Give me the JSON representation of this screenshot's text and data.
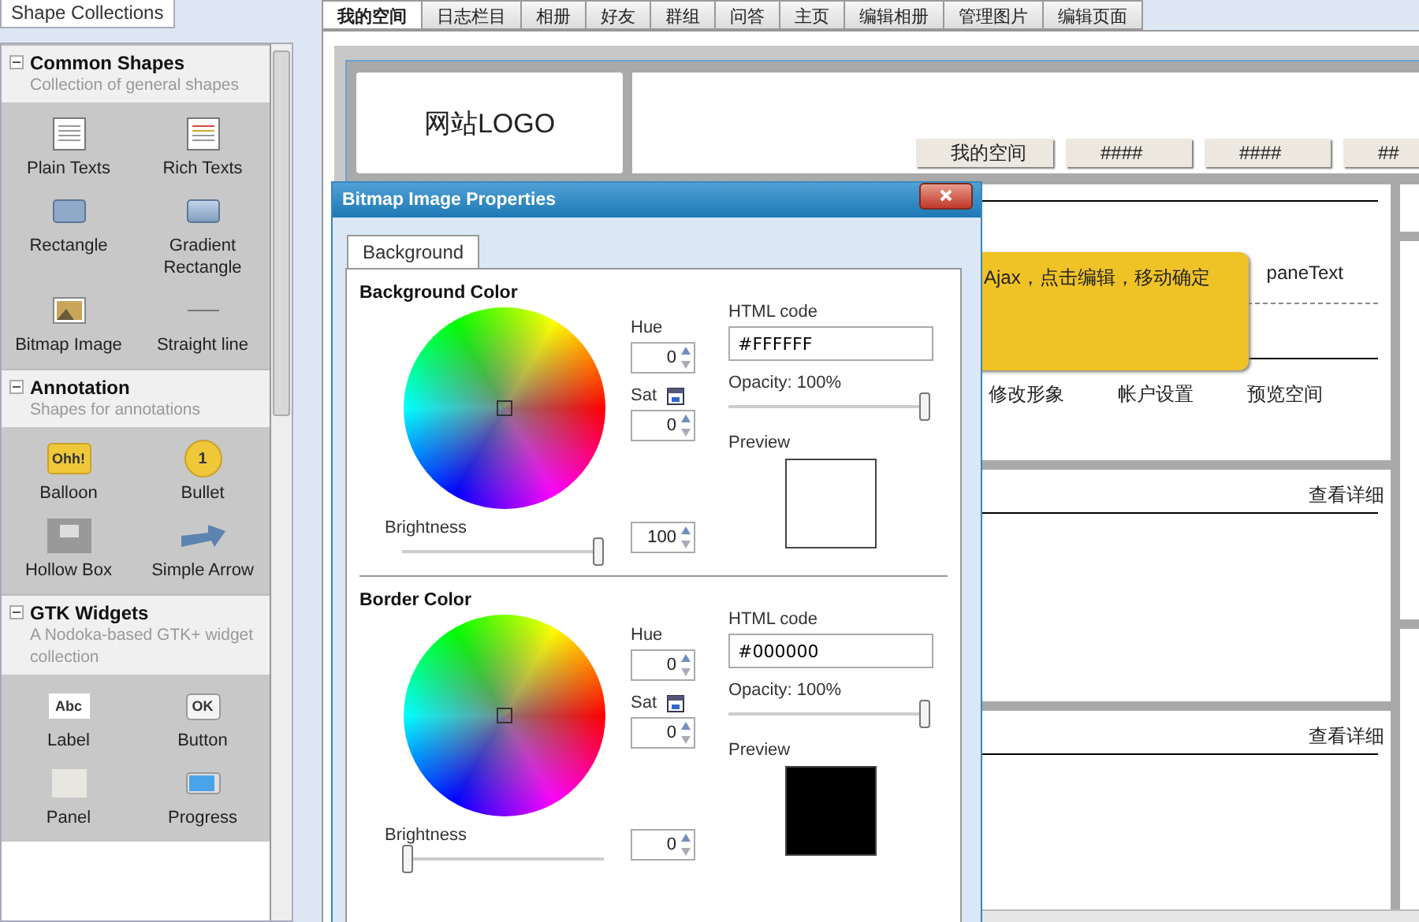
{
  "left_panel": {
    "tab": "Shape Collections",
    "sections": [
      {
        "title": "Common Shapes",
        "subtitle": "Collection of general shapes",
        "expanded": true,
        "items": [
          {
            "label": "Plain Texts",
            "kind": "plain-text"
          },
          {
            "label": "Rich Texts",
            "kind": "rich-text"
          },
          {
            "label": "Rectangle",
            "kind": "rectangle"
          },
          {
            "label": "Gradient Rectangle",
            "kind": "gradient-rectangle"
          },
          {
            "label": "Bitmap Image",
            "kind": "bitmap"
          },
          {
            "label": "Straight line",
            "kind": "line"
          }
        ]
      },
      {
        "title": "Annotation",
        "subtitle": "Shapes for annotations",
        "expanded": true,
        "items": [
          {
            "label": "Balloon",
            "kind": "balloon",
            "icon_text": "Ohh!"
          },
          {
            "label": "Bullet",
            "kind": "bullet",
            "icon_text": "1"
          },
          {
            "label": "Hollow Box",
            "kind": "hollow-box"
          },
          {
            "label": "Simple Arrow",
            "kind": "arrow"
          }
        ]
      },
      {
        "title": "GTK Widgets",
        "subtitle": "A Nodoka-based GTK+ widget collection",
        "expanded": true,
        "items": [
          {
            "label": "Label",
            "kind": "label",
            "icon_text": "Abc"
          },
          {
            "label": "Button",
            "kind": "button",
            "icon_text": "OK"
          },
          {
            "label": "Panel",
            "kind": "panel"
          },
          {
            "label": "Progress",
            "kind": "progress"
          }
        ]
      }
    ]
  },
  "tabs": [
    {
      "label": "我的空间",
      "selected": true
    },
    {
      "label": "日志栏目",
      "selected": false
    },
    {
      "label": "相册",
      "selected": false
    },
    {
      "label": "好友",
      "selected": false
    },
    {
      "label": "群组",
      "selected": false
    },
    {
      "label": "问答",
      "selected": false
    },
    {
      "label": "主页",
      "selected": false
    },
    {
      "label": "编辑相册",
      "selected": false
    },
    {
      "label": "管理图片",
      "selected": false
    },
    {
      "label": "编辑页面",
      "selected": false
    }
  ],
  "canvas": {
    "logo": "网站LOGO",
    "nav": [
      "我的空间",
      "####",
      "####",
      "##"
    ],
    "profile_panel": {
      "tooltip": "Ajax，点击编辑，移动确定",
      "text": "paneText",
      "links": [
        "修改形象",
        "帐户设置",
        "预览空间"
      ]
    },
    "panels": [
      {
        "link": "查看详细"
      },
      {
        "link": "查看详细"
      }
    ]
  },
  "dialog": {
    "title": "Bitmap Image Properties",
    "tabs": [
      {
        "label": "Background",
        "selected": true
      }
    ],
    "sections": [
      {
        "title": "Background Color",
        "hue_label": "Hue",
        "hue": "0",
        "sat_label": "Sat",
        "sat": "0",
        "brightness_label": "Brightness",
        "brightness_slider": {
          "level": 1
        },
        "brightness": "100",
        "html_label": "HTML code",
        "html_code": "#FFFFFF",
        "opacity_label": "Opacity: 100%",
        "opacity_slider": {
          "level": 1
        },
        "preview_label": "Preview"
      },
      {
        "title": "Border Color",
        "hue_label": "Hue",
        "hue": "0",
        "sat_label": "Sat",
        "sat": "0",
        "brightness_label": "Brightness",
        "brightness_slider": {
          "level": 0
        },
        "brightness": "0",
        "html_label": "HTML code",
        "html_code": "#000000",
        "opacity_label": "Opacity: 100%",
        "opacity_slider": {
          "level": 1
        },
        "preview_label": "Preview"
      }
    ]
  }
}
